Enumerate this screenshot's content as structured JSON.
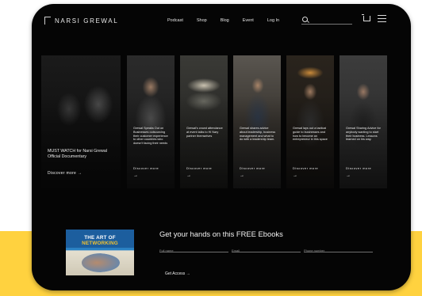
{
  "brand": {
    "name": "NARSI GREWAL"
  },
  "nav": {
    "items": [
      "Podcast",
      "Shop",
      "Blog",
      "Event",
      "Log In"
    ]
  },
  "header": {
    "search_placeholder": ""
  },
  "featured": {
    "description": "MUST WATCH for Narsi Grewal Official Documentary",
    "cta": "Discover more"
  },
  "cards": [
    {
      "description": "Grewal Speaks Out on Businesses outsourcing their customer experience to other countries who doesn't facing their needs",
      "cta": "Discover more"
    },
    {
      "description": "Grewal's crowd attendance at event talks to Hi Nary partner themselves",
      "cta": "Discover more"
    },
    {
      "description": "Grewal shares advice about leadership, business management and what to do with a leadership team.",
      "cta": "Discover more"
    },
    {
      "description": "Grewal lays out a tactical guide to businesses and how to become an entrepreneur in this space",
      "cta": "Discover more"
    },
    {
      "description": "Grewal Sharing Advice for anybody wanting to start their business. Lessons learned on his way.",
      "cta": "Discover more"
    }
  ],
  "ebook": {
    "cover_title_a": "THE ART OF ",
    "cover_title_b": "NETWORKING",
    "heading": "Get your hands on this FREE Ebooks",
    "fields": [
      {
        "placeholder": "Full name"
      },
      {
        "placeholder": "Email"
      },
      {
        "placeholder": "Phone number"
      }
    ],
    "cta": "Get Access →"
  },
  "colors": {
    "accent_yellow": "#ffd23f",
    "panel": "#050505",
    "ebook_blue": "#1c5e9e"
  }
}
